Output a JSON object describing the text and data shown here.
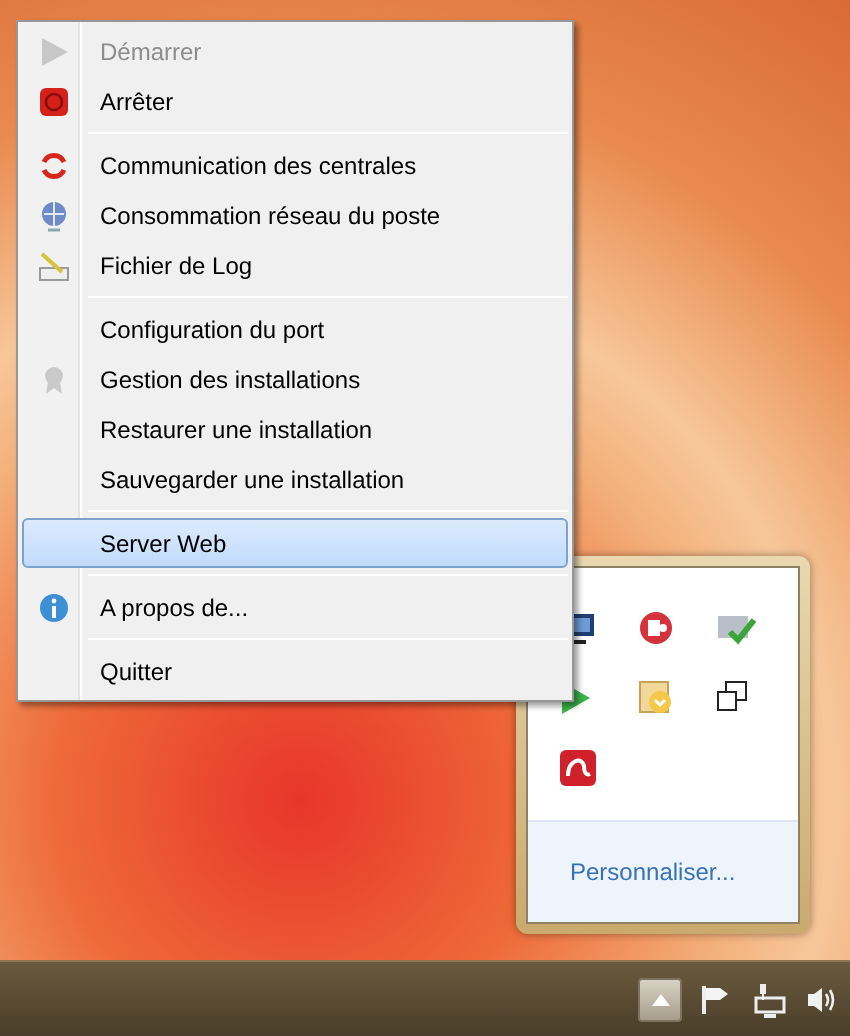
{
  "context_menu": {
    "items": [
      {
        "kind": "item",
        "label": "Démarrer",
        "disabled": true,
        "selected": false
      },
      {
        "kind": "item",
        "label": "Arrêter",
        "disabled": false,
        "selected": false
      },
      {
        "kind": "separator"
      },
      {
        "kind": "item",
        "label": "Communication des centrales",
        "disabled": false,
        "selected": false
      },
      {
        "kind": "item",
        "label": "Consommation réseau du poste",
        "disabled": false,
        "selected": false
      },
      {
        "kind": "item",
        "label": "Fichier de Log",
        "disabled": false,
        "selected": false
      },
      {
        "kind": "separator"
      },
      {
        "kind": "item",
        "label": "Configuration du port",
        "disabled": false,
        "selected": false
      },
      {
        "kind": "item",
        "label": "Gestion des installations",
        "disabled": false,
        "selected": false
      },
      {
        "kind": "item",
        "label": "Restaurer une installation",
        "disabled": false,
        "selected": false
      },
      {
        "kind": "item",
        "label": "Sauvegarder une installation",
        "disabled": false,
        "selected": false
      },
      {
        "kind": "separator"
      },
      {
        "kind": "item",
        "label": "Server Web",
        "disabled": false,
        "selected": true
      },
      {
        "kind": "separator"
      },
      {
        "kind": "item",
        "label": "A propos de...",
        "disabled": false,
        "selected": false
      },
      {
        "kind": "separator"
      },
      {
        "kind": "item",
        "label": "Quitter",
        "disabled": false,
        "selected": false
      }
    ]
  },
  "tray_flyout": {
    "link": "Personnaliser..."
  }
}
